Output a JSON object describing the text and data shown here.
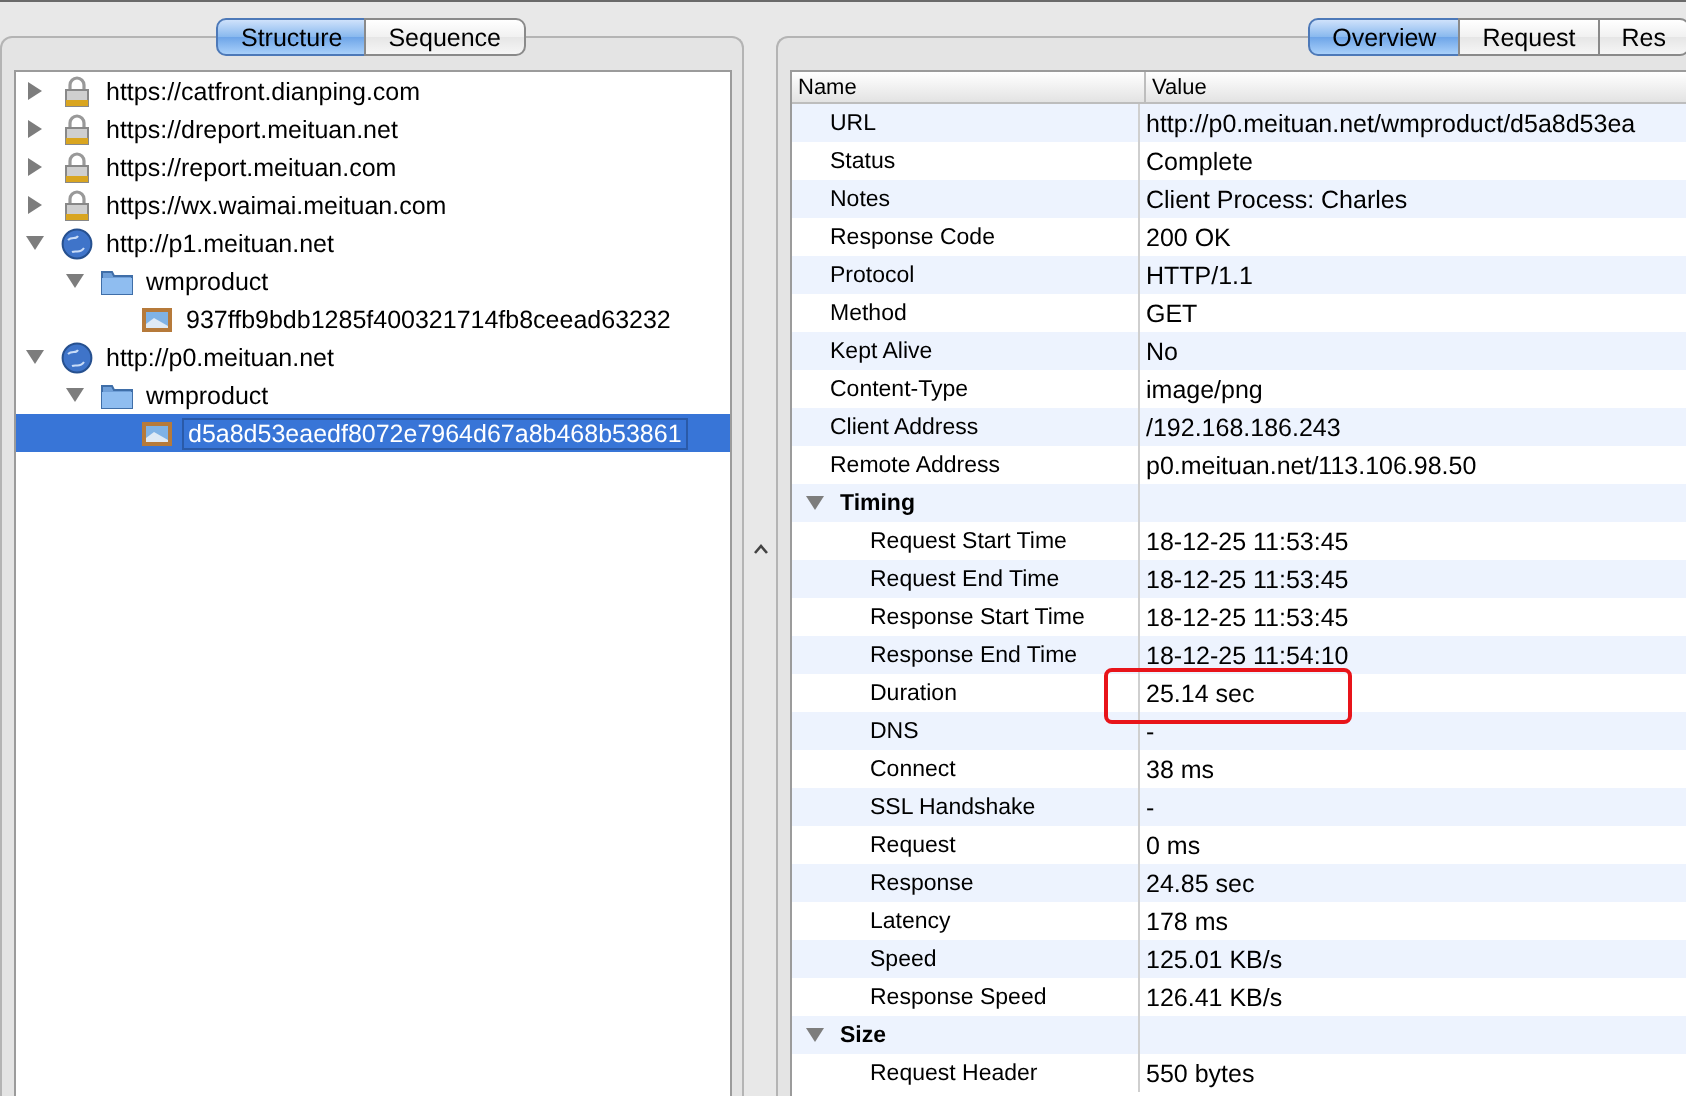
{
  "left_tabs": [
    {
      "label": "Structure",
      "selected": true
    },
    {
      "label": "Sequence",
      "selected": false
    }
  ],
  "tree": [
    {
      "label": "https://catfront.dianping.com",
      "kind": "lock",
      "expanded": false,
      "selected": false
    },
    {
      "label": "https://dreport.meituan.net",
      "kind": "lock",
      "expanded": false,
      "selected": false
    },
    {
      "label": "https://report.meituan.com",
      "kind": "lock",
      "expanded": false,
      "selected": false
    },
    {
      "label": "https://wx.waimai.meituan.com",
      "kind": "lock",
      "expanded": false,
      "selected": false
    },
    {
      "label": "http://p1.meituan.net",
      "kind": "globe",
      "expanded": true,
      "selected": false,
      "children": [
        {
          "label": "wmproduct",
          "kind": "folder",
          "expanded": true,
          "selected": false,
          "children": [
            {
              "label": "937ffb9bdb1285f400321714fb8ceead63232",
              "kind": "image",
              "selected": false
            }
          ]
        }
      ]
    },
    {
      "label": "http://p0.meituan.net",
      "kind": "globe",
      "expanded": true,
      "selected": false,
      "children": [
        {
          "label": "wmproduct",
          "kind": "folder",
          "expanded": true,
          "selected": false,
          "children": [
            {
              "label": "d5a8d53eaedf8072e7964d67a8b468b53861",
              "kind": "image",
              "selected": true
            }
          ]
        }
      ]
    }
  ],
  "right_tabs": [
    {
      "label": "Overview",
      "selected": true
    },
    {
      "label": "Request",
      "selected": false
    },
    {
      "label": "Res",
      "selected": false
    }
  ],
  "table": {
    "columns": [
      "Name",
      "Value"
    ],
    "rows": [
      {
        "kind": "row",
        "name": "URL",
        "value": "http://p0.meituan.net/wmproduct/d5a8d53ea"
      },
      {
        "kind": "row",
        "name": "Status",
        "value": "Complete"
      },
      {
        "kind": "row",
        "name": "Notes",
        "value": "Client Process: Charles"
      },
      {
        "kind": "row",
        "name": "Response Code",
        "value": "200 OK"
      },
      {
        "kind": "row",
        "name": "Protocol",
        "value": "HTTP/1.1"
      },
      {
        "kind": "row",
        "name": "Method",
        "value": "GET"
      },
      {
        "kind": "row",
        "name": "Kept Alive",
        "value": "No"
      },
      {
        "kind": "row",
        "name": "Content-Type",
        "value": "image/png"
      },
      {
        "kind": "row",
        "name": "Client Address",
        "value": "/192.168.186.243"
      },
      {
        "kind": "row",
        "name": "Remote Address",
        "value": "p0.meituan.net/113.106.98.50"
      },
      {
        "kind": "group",
        "name": "Timing",
        "expanded": true,
        "children": [
          {
            "kind": "row",
            "name": "Request Start Time",
            "value": "18-12-25 11:53:45"
          },
          {
            "kind": "row",
            "name": "Request End Time",
            "value": "18-12-25 11:53:45"
          },
          {
            "kind": "row",
            "name": "Response Start Time",
            "value": "18-12-25 11:53:45"
          },
          {
            "kind": "row",
            "name": "Response End Time",
            "value": "18-12-25 11:54:10"
          },
          {
            "kind": "row",
            "name": "Duration",
            "value": "25.14 sec",
            "highlighted": true
          },
          {
            "kind": "row",
            "name": "DNS",
            "value": "-"
          },
          {
            "kind": "row",
            "name": "Connect",
            "value": "38 ms"
          },
          {
            "kind": "row",
            "name": "SSL Handshake",
            "value": "-"
          },
          {
            "kind": "row",
            "name": "Request",
            "value": "0 ms"
          },
          {
            "kind": "row",
            "name": "Response",
            "value": "24.85 sec"
          },
          {
            "kind": "row",
            "name": "Latency",
            "value": "178 ms"
          },
          {
            "kind": "row",
            "name": "Speed",
            "value": "125.01 KB/s"
          },
          {
            "kind": "row",
            "name": "Response Speed",
            "value": "126.41 KB/s"
          }
        ]
      },
      {
        "kind": "group",
        "name": "Size",
        "expanded": true,
        "children": [
          {
            "kind": "row",
            "name": "Request Header",
            "value": "550 bytes"
          }
        ]
      }
    ]
  }
}
